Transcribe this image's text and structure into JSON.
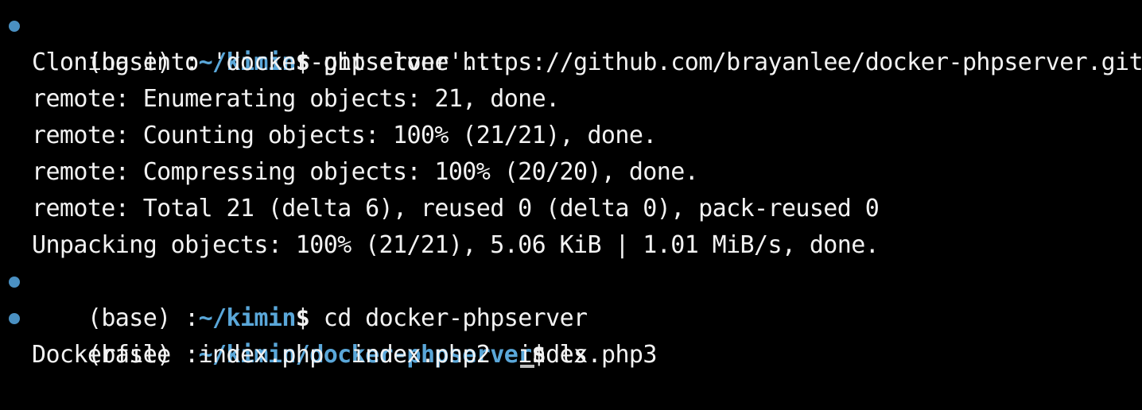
{
  "colors": {
    "background": "#000000",
    "text": "#f2f2f2",
    "path": "#5aa7d9",
    "prompt_marker": "#4a90c2"
  },
  "icons": {
    "prompt_marker": "circle-dot-icon"
  },
  "session": [
    {
      "type": "prompt",
      "env": "(base) ",
      "colon": ":",
      "path": "~/kimin",
      "dollar": "$",
      "command": " git clone https://github.com/brayanlee/docker-phpserver.git"
    },
    {
      "type": "output",
      "text": "Cloning into 'docker-phpserver'..."
    },
    {
      "type": "output",
      "text": "remote: Enumerating objects: 21, done."
    },
    {
      "type": "output",
      "text": "remote: Counting objects: 100% (21/21), done."
    },
    {
      "type": "output",
      "text": "remote: Compressing objects: 100% (20/20), done."
    },
    {
      "type": "output",
      "text": "remote: Total 21 (delta 6), reused 0 (delta 0), pack-reused 0"
    },
    {
      "type": "output",
      "text": "Unpacking objects: 100% (21/21), 5.06 KiB | 1.01 MiB/s, done."
    },
    {
      "type": "prompt",
      "env": "(base) ",
      "colon": ":",
      "path": "~/kimin",
      "dollar": "$",
      "command": " cd docker-phpserver"
    },
    {
      "type": "prompt",
      "env": "(base) ",
      "colon": ":",
      "path": "~/kimin/docker-phpserver",
      "dollar": "$",
      "command": " ls"
    },
    {
      "type": "ls",
      "files": [
        "Dockerfile",
        "index.php",
        "index.php2",
        "index.php3"
      ]
    }
  ]
}
